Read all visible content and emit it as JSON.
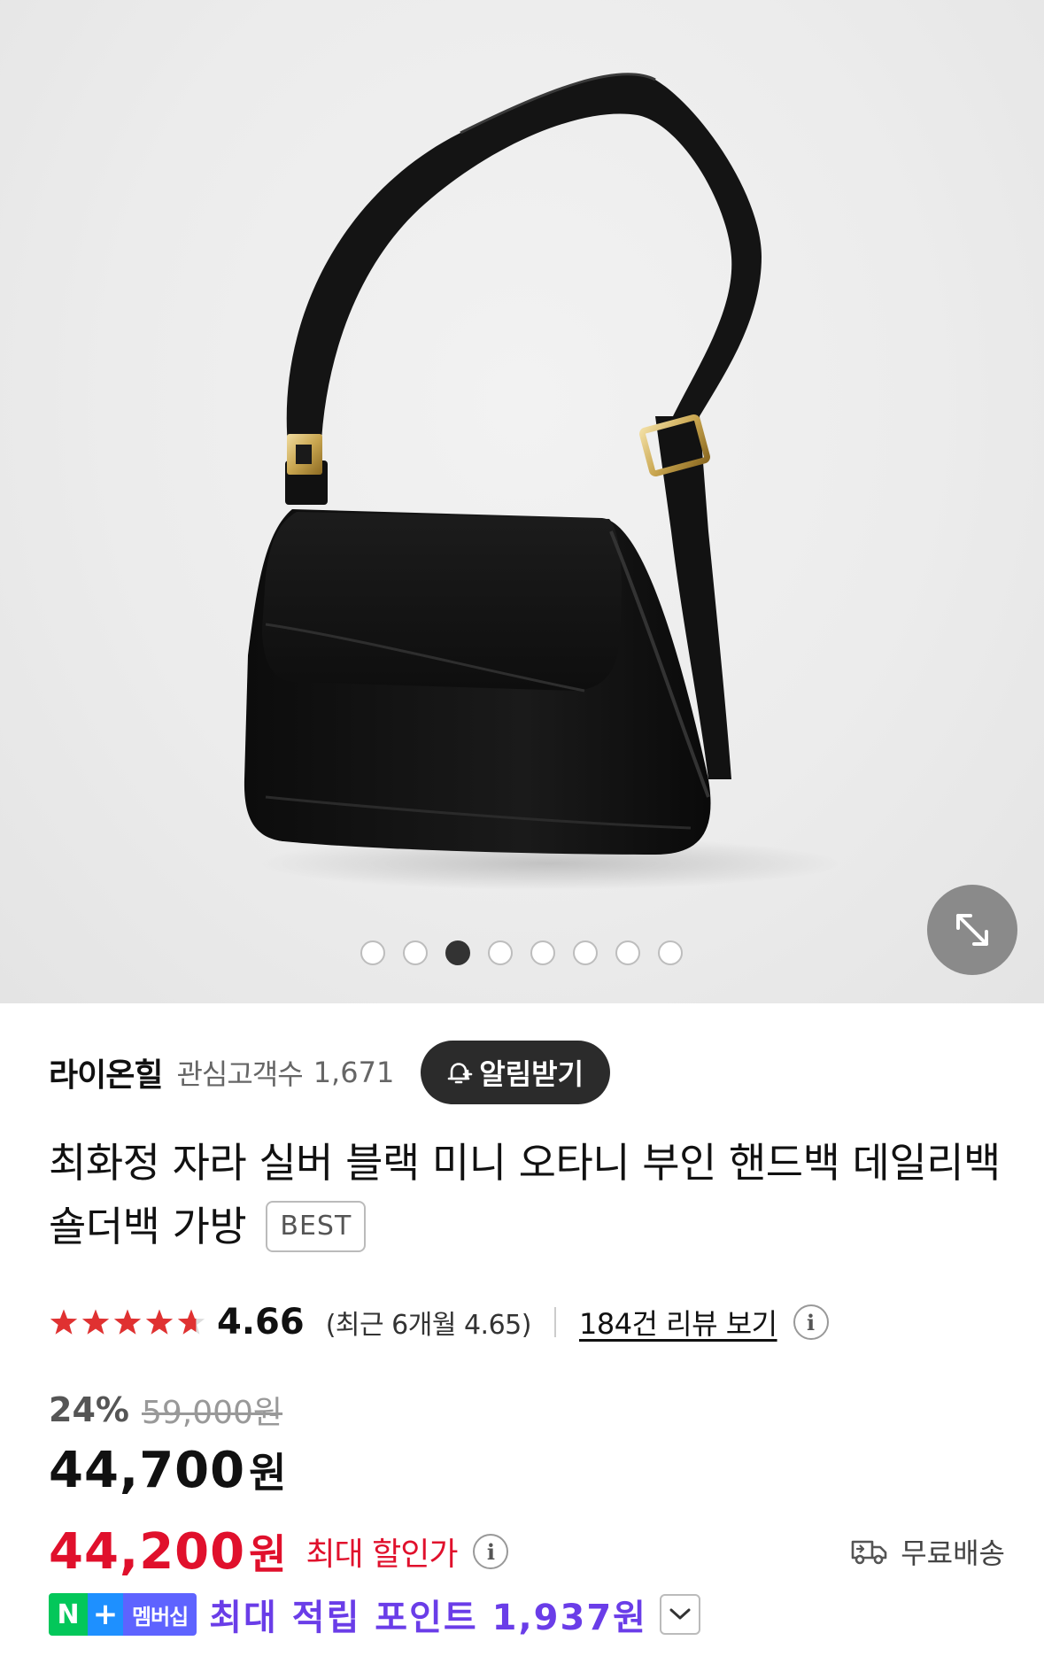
{
  "gallery": {
    "image_alt": "black shoulder bag",
    "total_images": 8,
    "active_index": 2
  },
  "store": {
    "name": "라이온힐",
    "fans_label": "관심고객수",
    "fans_count": "1,671",
    "alarm_button": "알림받기"
  },
  "product": {
    "title": "최화정 자라 실버 블랙 미니 오타니 부인 핸드백 데일리백 숄더백 가방",
    "badge": "BEST"
  },
  "rating": {
    "stars": 4.66,
    "value": "4.66",
    "recent": "(최근 6개월 4.65)",
    "review_link": "184건 리뷰 보기",
    "info_icon": "i"
  },
  "price": {
    "discount": "24%",
    "original": "59,000원",
    "sale": "44,700",
    "sale_unit": "원",
    "max_discount": "44,200",
    "max_unit": "원",
    "max_label": "최대 할인가",
    "shipping": "무료배송"
  },
  "points": {
    "n_label": "N",
    "plus_label": "+",
    "member_label": "멤버십",
    "text": "최대 적립 포인트 1,937원"
  },
  "colors": {
    "accent_red": "#e0102c",
    "point_purple": "#6a3de8",
    "naver_green": "#03c75a",
    "star_red": "#e03131"
  },
  "icons": [
    "expand-icon",
    "bell-plus-icon",
    "star-icon",
    "info-icon",
    "truck-icon",
    "chevron-down-icon"
  ]
}
